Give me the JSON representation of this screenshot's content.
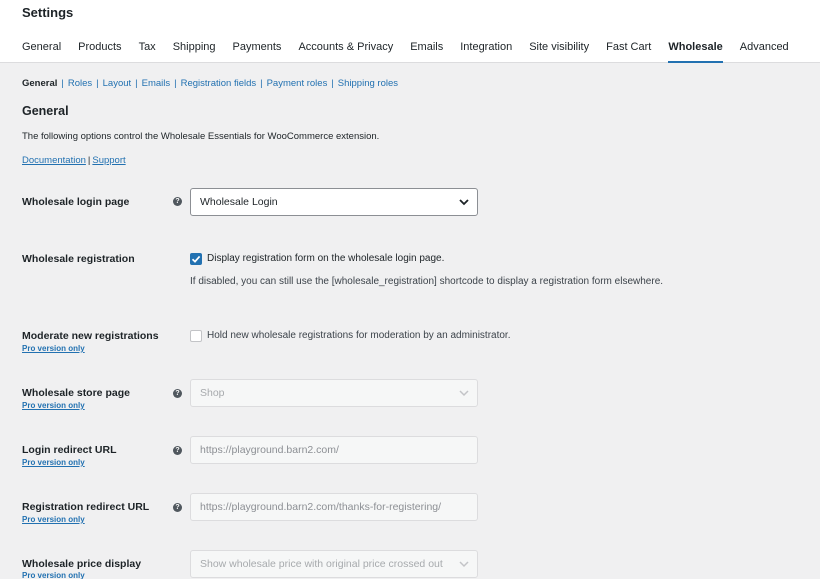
{
  "header": {
    "title": "Settings",
    "tabs": [
      "General",
      "Products",
      "Tax",
      "Shipping",
      "Payments",
      "Accounts & Privacy",
      "Emails",
      "Integration",
      "Site visibility",
      "Fast Cart",
      "Wholesale",
      "Advanced"
    ],
    "active_tab": "Wholesale"
  },
  "subnav": {
    "current": "General",
    "links": [
      "Roles",
      "Layout",
      "Emails",
      "Registration fields",
      "Payment roles",
      "Shipping roles"
    ],
    "separator": "|"
  },
  "section": {
    "title": "General",
    "description": "The following options control the Wholesale Essentials for WooCommerce extension.",
    "documentation_link": "Documentation",
    "support_link": "Support",
    "link_separator": "|"
  },
  "pro_text": "Pro version only",
  "fields": {
    "login_page": {
      "label": "Wholesale login page",
      "value": "Wholesale Login"
    },
    "registration": {
      "label": "Wholesale registration",
      "checkbox_label": "Display registration form on the wholesale login page.",
      "checked": true,
      "hint": "If disabled, you can still use the [wholesale_registration] shortcode to display a registration form elsewhere."
    },
    "moderate": {
      "label": "Moderate new registrations",
      "checkbox_label": "Hold new wholesale registrations for moderation by an administrator.",
      "checked": false
    },
    "store_page": {
      "label": "Wholesale store page",
      "value": "Shop"
    },
    "login_redirect": {
      "label": "Login redirect URL",
      "placeholder": "https://playground.barn2.com/"
    },
    "registration_redirect": {
      "label": "Registration redirect URL",
      "placeholder": "https://playground.barn2.com/thanks-for-registering/"
    },
    "price_display": {
      "label": "Wholesale price display",
      "value": "Show wholesale price with original price crossed out"
    }
  },
  "colors": {
    "accent": "#2271b1",
    "background": "#f0f0f1",
    "help_icon": "#50575e"
  },
  "icons": {
    "help": "help-icon",
    "chevron": "chevron-down-icon",
    "checkmark": "checkmark-icon"
  }
}
